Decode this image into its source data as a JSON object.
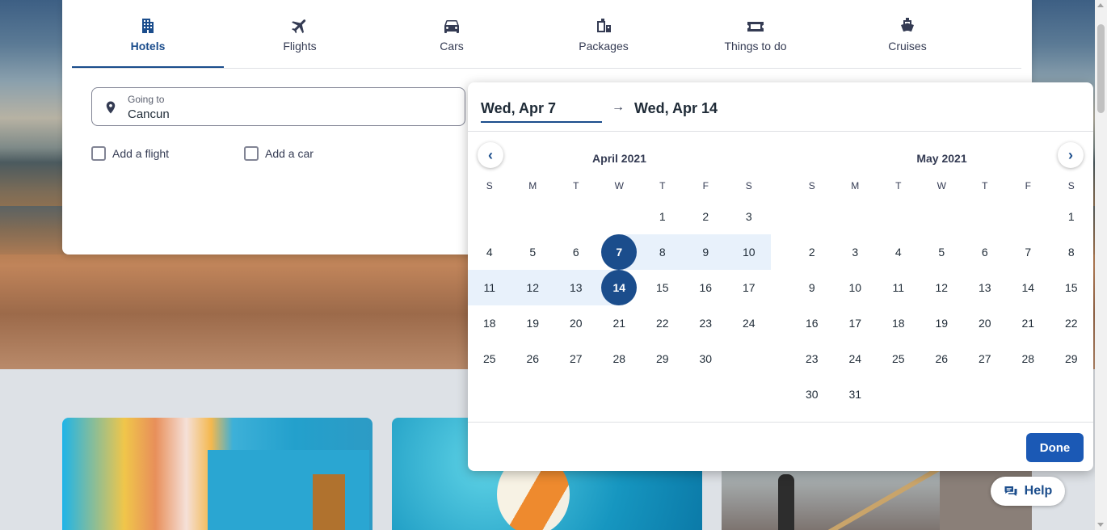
{
  "tabs": [
    {
      "label": "Hotels",
      "icon": "hotel-icon",
      "active": true
    },
    {
      "label": "Flights",
      "icon": "flight-icon"
    },
    {
      "label": "Cars",
      "icon": "car-icon"
    },
    {
      "label": "Packages",
      "icon": "packages-icon"
    },
    {
      "label": "Things to do",
      "icon": "activities-icon"
    },
    {
      "label": "Cruises",
      "icon": "cruise-icon"
    }
  ],
  "search": {
    "going_to_label": "Going to",
    "going_to_value": "Cancun",
    "add_flight": "Add a flight",
    "add_car": "Add a car"
  },
  "datepicker": {
    "start_date": "Wed, Apr 7",
    "end_date": "Wed, Apr 14",
    "arrow": "→",
    "prev": "‹",
    "next": "›",
    "weekdays": [
      "S",
      "M",
      "T",
      "W",
      "T",
      "F",
      "S"
    ],
    "months": [
      {
        "title": "April 2021",
        "first_weekday": 4,
        "days": 30,
        "selected": [
          7,
          14
        ],
        "range": [
          7,
          14
        ]
      },
      {
        "title": "May 2021",
        "first_weekday": 6,
        "days": 31,
        "selected": [],
        "range": []
      }
    ],
    "done_label": "Done"
  },
  "help_label": "Help",
  "colors": {
    "brand": "#1b4d8c",
    "range": "#e8f1fb",
    "done": "#1b59b5"
  }
}
